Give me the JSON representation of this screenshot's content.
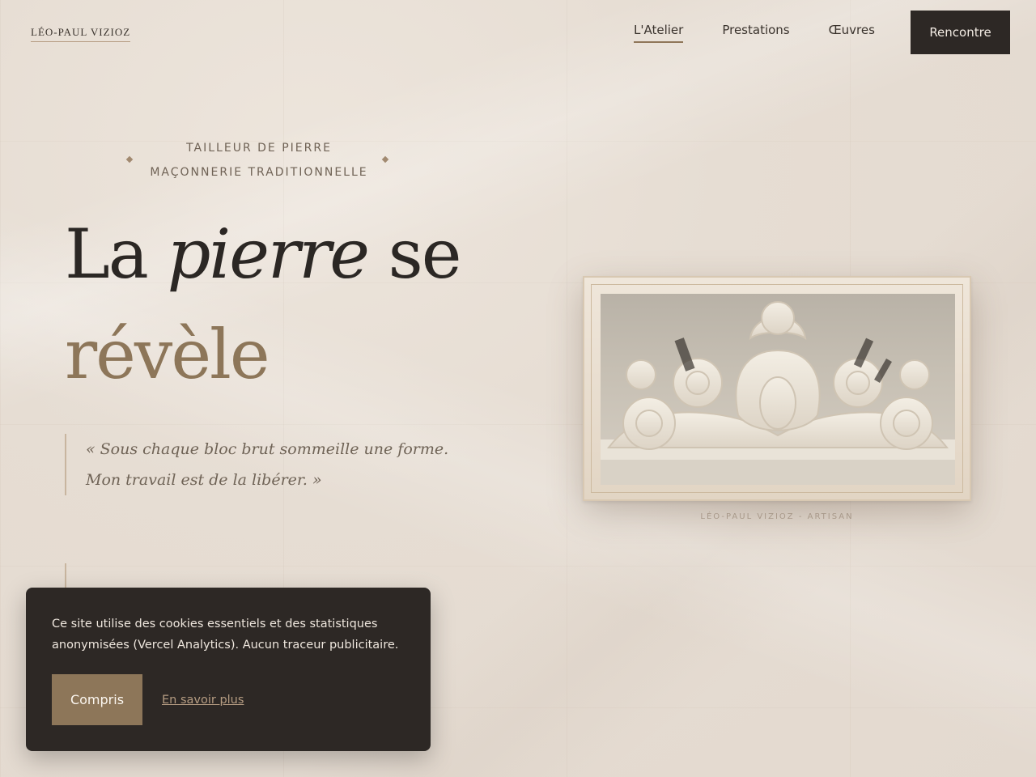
{
  "header": {
    "logo": "LÉO-PAUL VIZIOZ",
    "nav": [
      {
        "label": "L'Atelier",
        "active": true
      },
      {
        "label": "Prestations",
        "active": false
      },
      {
        "label": "Œuvres",
        "active": false
      }
    ],
    "cta_label": "Rencontre"
  },
  "hero": {
    "eyebrow_line1": "TAILLEUR DE PIERRE",
    "eyebrow_line2": "MAÇONNERIE TRADITIONNELLE",
    "title_part1": "La ",
    "title_italic": "pierre",
    "title_part2": " se",
    "title_accent": "révèle",
    "quote": "« Sous chaque bloc brut sommeille une forme. Mon travail est de la libérer. »"
  },
  "image": {
    "caption": "LÉO-PAUL VIZIOZ - ARTISAN",
    "icon": "carved-stone-ornament-photo"
  },
  "cookie_banner": {
    "text": "Ce site utilise des cookies essentiels et des statistiques anonymisées (Vercel Analytics). Aucun traceur publicitaire.",
    "accept_label": "Compris",
    "more_label": "En savoir plus"
  },
  "colors": {
    "background": "#e6ddd3",
    "dark": "#2d2825",
    "accent": "#8d7659"
  }
}
